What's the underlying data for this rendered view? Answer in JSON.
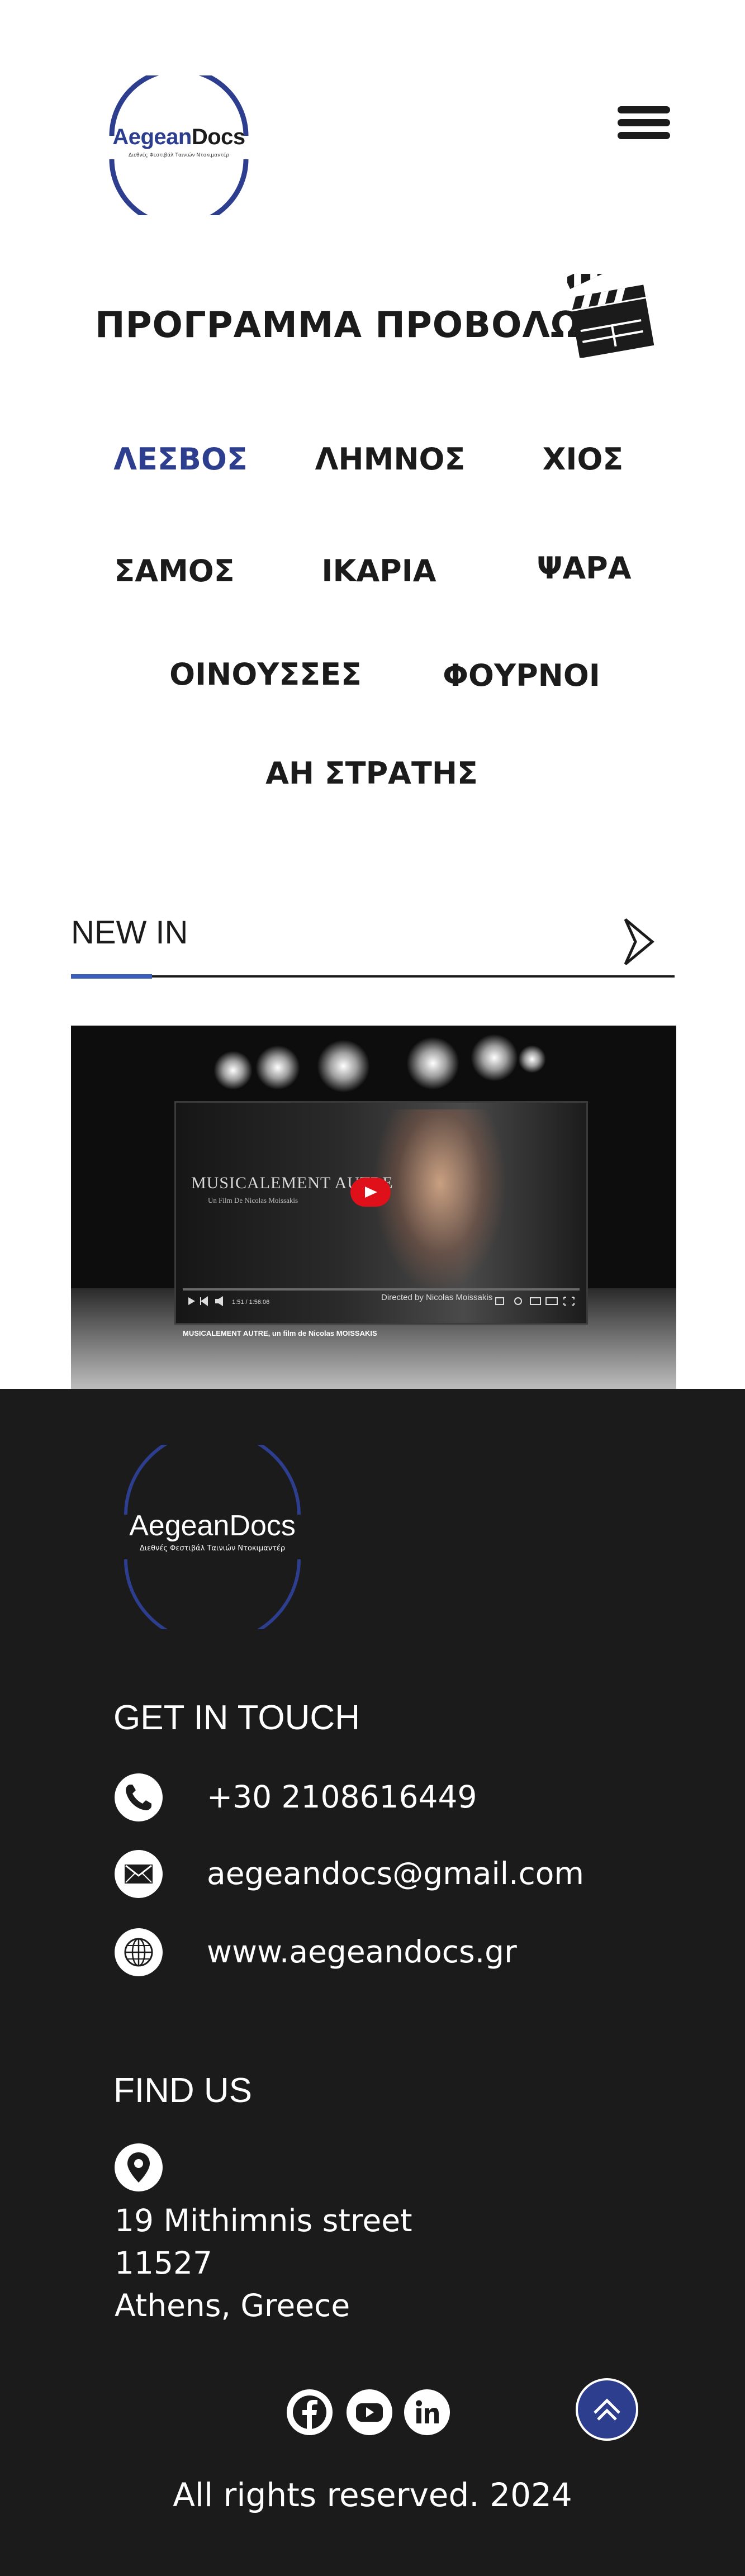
{
  "header": {
    "logo_brand_part1": "Aegean",
    "logo_brand_part2": "Docs",
    "logo_tagline": "Διεθνές Φεστιβάλ Ταινιών Ντοκιμαντέρ",
    "menu_icon": "hamburger-menu-icon"
  },
  "program": {
    "title": "ΠΡΟΓΡΑΜΜΑ ΠΡΟΒΟΛΩΝ",
    "icon": "clapperboard-icon"
  },
  "islands": {
    "items": [
      "ΛΕΣΒΟΣ",
      "ΛΗΜΝΟΣ",
      "ΧΙΟΣ",
      "ΣΑΜΟΣ",
      "ΙΚΑΡΙΑ",
      "ΨΑΡΑ",
      "ΟΙΝΟΥΣΣΕΣ",
      "ΦΟΥΡΝΟΙ",
      "ΑΗ ΣΤΡΑΤΗΣ"
    ],
    "active": "ΛΕΣΒΟΣ"
  },
  "new_in": {
    "label": "NEW IN",
    "arrow_icon": "chevron-right-icon"
  },
  "video": {
    "title": "MUSICALEMENT AUTRE",
    "subtitle": "Un Film De Nicolas Moissakis",
    "directed_by": "Directed by Nicolas Moissakis",
    "caption": "MUSICALEMENT AUTRE, un film de Nicolas MOISSAKIS",
    "time": "1:51 / 1:56:06"
  },
  "footer": {
    "logo_brand": "AegeanDocs",
    "logo_tagline": "Διεθνές Φεστιβάλ Ταινιών Ντοκιμαντέρ",
    "get_in_touch": "GET IN TOUCH",
    "phone": "+30 2108616449",
    "email": "aegeandocs@gmail.com",
    "website": "www.aegeandocs.gr",
    "find_us": "FIND US",
    "address_line1": "19 Mithimnis street",
    "address_line2": "11527",
    "address_line3": "Athens, Greece",
    "rights": "All rights reserved. 2024"
  },
  "colors": {
    "brand_blue": "#2d3e8f",
    "accent_blue": "#3a5fb8",
    "footer_bg": "#1b1b1b",
    "text_dark": "#1b1b1b"
  }
}
